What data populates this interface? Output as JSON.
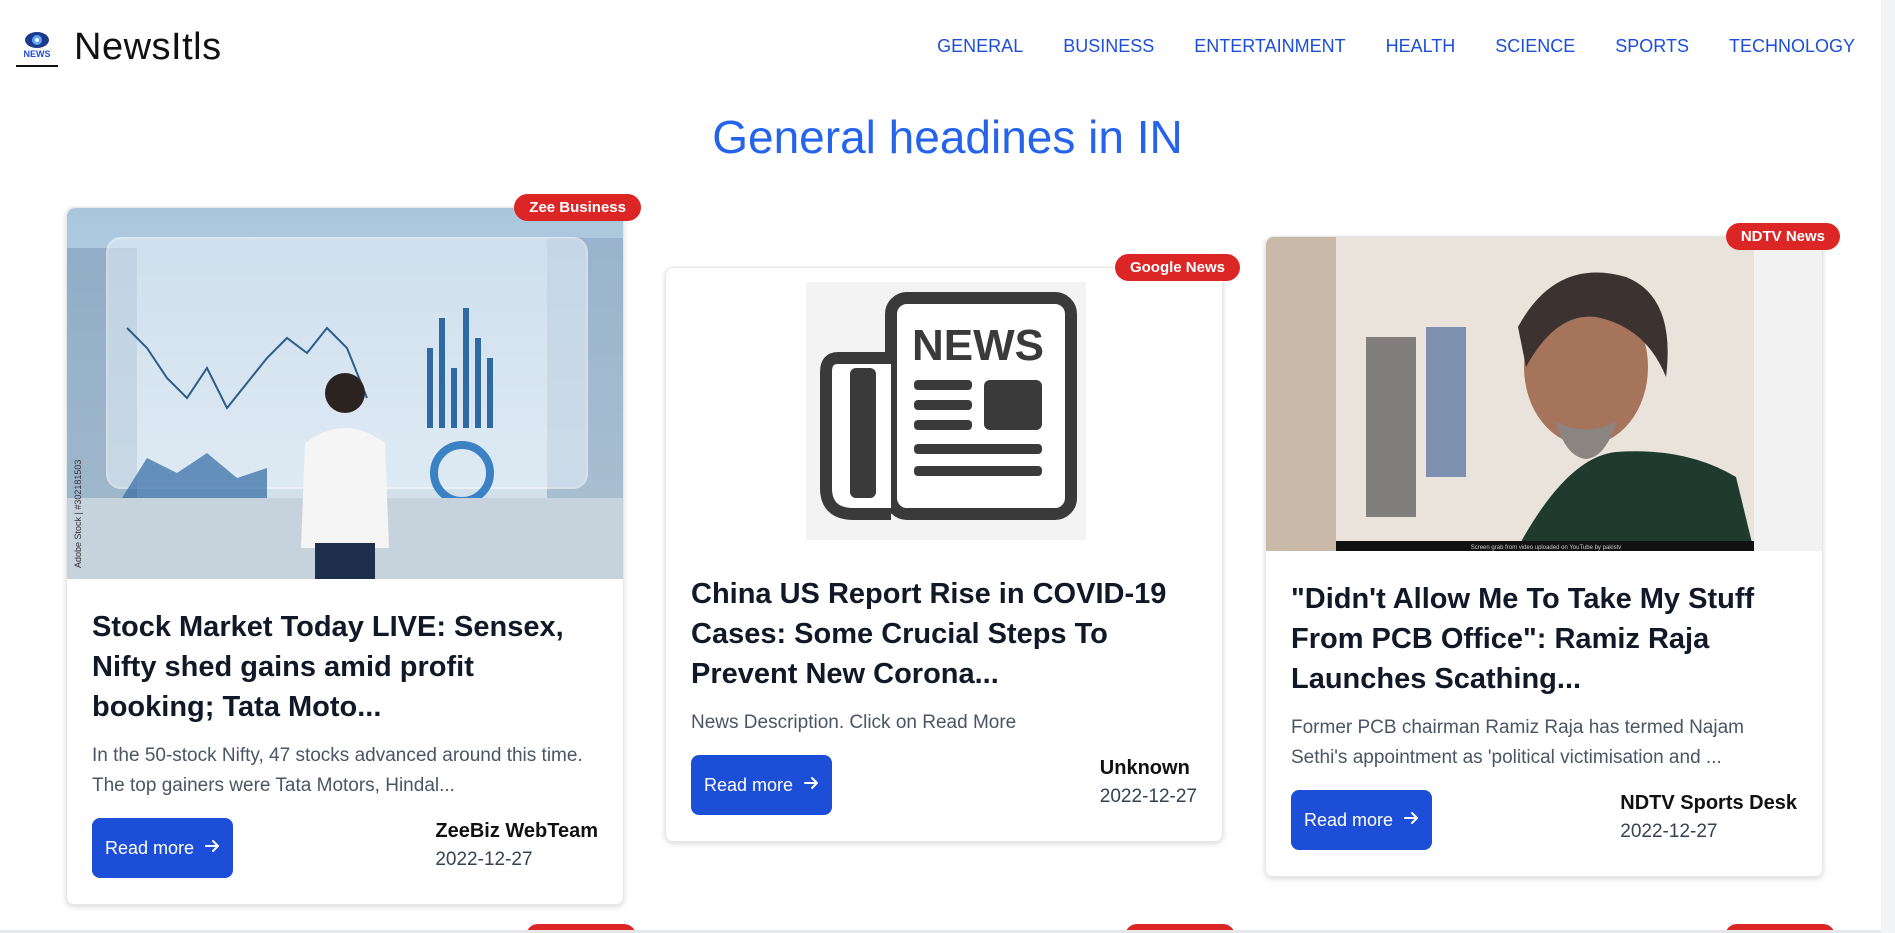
{
  "app": {
    "brand": "NewsItls",
    "logo_text": "NEWS",
    "nav": [
      "GENERAL",
      "BUSINESS",
      "ENTERTAINMENT",
      "HEALTH",
      "SCIENCE",
      "SPORTS",
      "TECHNOLOGY"
    ]
  },
  "headline": "General headines in IN",
  "cards": [
    {
      "source": "Zee Business",
      "title": "Stock Market Today LIVE: Sensex, Nifty shed gains amid profit booking; Tata Moto...",
      "description": "In the 50-stock Nifty, 47 stocks advanced around this time. The top gainers were Tata Motors, Hindal...",
      "button": "Read more",
      "author": "ZeeBiz WebTeam",
      "date": "2022-12-27",
      "image_caption": "Adobe Stock | #302181503"
    },
    {
      "source": "Google News",
      "title": "China US Report Rise in COVID-19 Cases: Some Crucial Steps To Prevent New Corona...",
      "description": "News Description. Click on Read More",
      "button": "Read more",
      "author": "Unknown",
      "date": "2022-12-27",
      "image_caption": "NEWS"
    },
    {
      "source": "NDTV News",
      "title": "\"Didn't Allow Me To Take My Stuff From PCB Office\": Ramiz Raja Launches Scathing...",
      "description": "Former PCB chairman Ramiz Raja has termed Najam Sethi's appointment as 'political victimisation and ...",
      "button": "Read more",
      "author": "NDTV Sports Desk",
      "date": "2022-12-27",
      "image_caption": "Screen grab from video uploaded on YouTube by pakistv"
    }
  ],
  "colors": {
    "accent": "#1d4ed8",
    "badge": "#dc2626",
    "headline": "#2563eb"
  }
}
